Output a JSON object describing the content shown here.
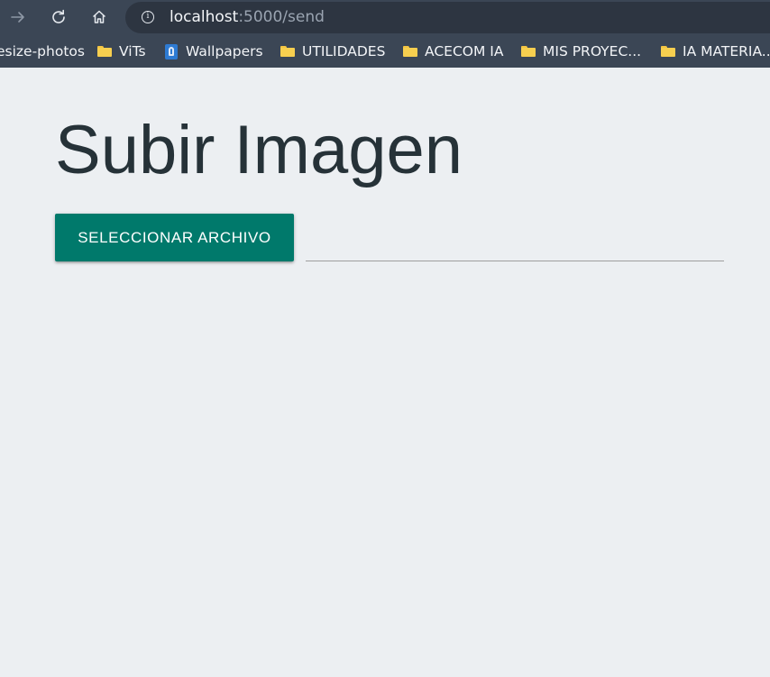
{
  "browser": {
    "url_host": "localhost",
    "url_path": ":5000/send",
    "bookmarks": [
      {
        "label": "esize-photos",
        "icon": "none"
      },
      {
        "label": "ViTs",
        "icon": "folder-icon"
      },
      {
        "label": "Wallpapers",
        "icon": "wallpaper-icon"
      },
      {
        "label": "UTILIDADES",
        "icon": "folder-icon"
      },
      {
        "label": "ACECOM IA",
        "icon": "folder-icon"
      },
      {
        "label": "MIS PROYEC...",
        "icon": "folder-icon"
      },
      {
        "label": "IA MATERIA...",
        "icon": "folder-icon"
      }
    ]
  },
  "page": {
    "title": "Subir Imagen",
    "select_button_label": "Seleccionar archivo",
    "file_path_value": ""
  },
  "colors": {
    "browser_chrome": "#3b4655",
    "omnibox": "#2d3541",
    "page_background": "#eceff2",
    "title_text": "#263238",
    "button_background": "#00796b",
    "folder_icon": "#f7cf4f"
  }
}
